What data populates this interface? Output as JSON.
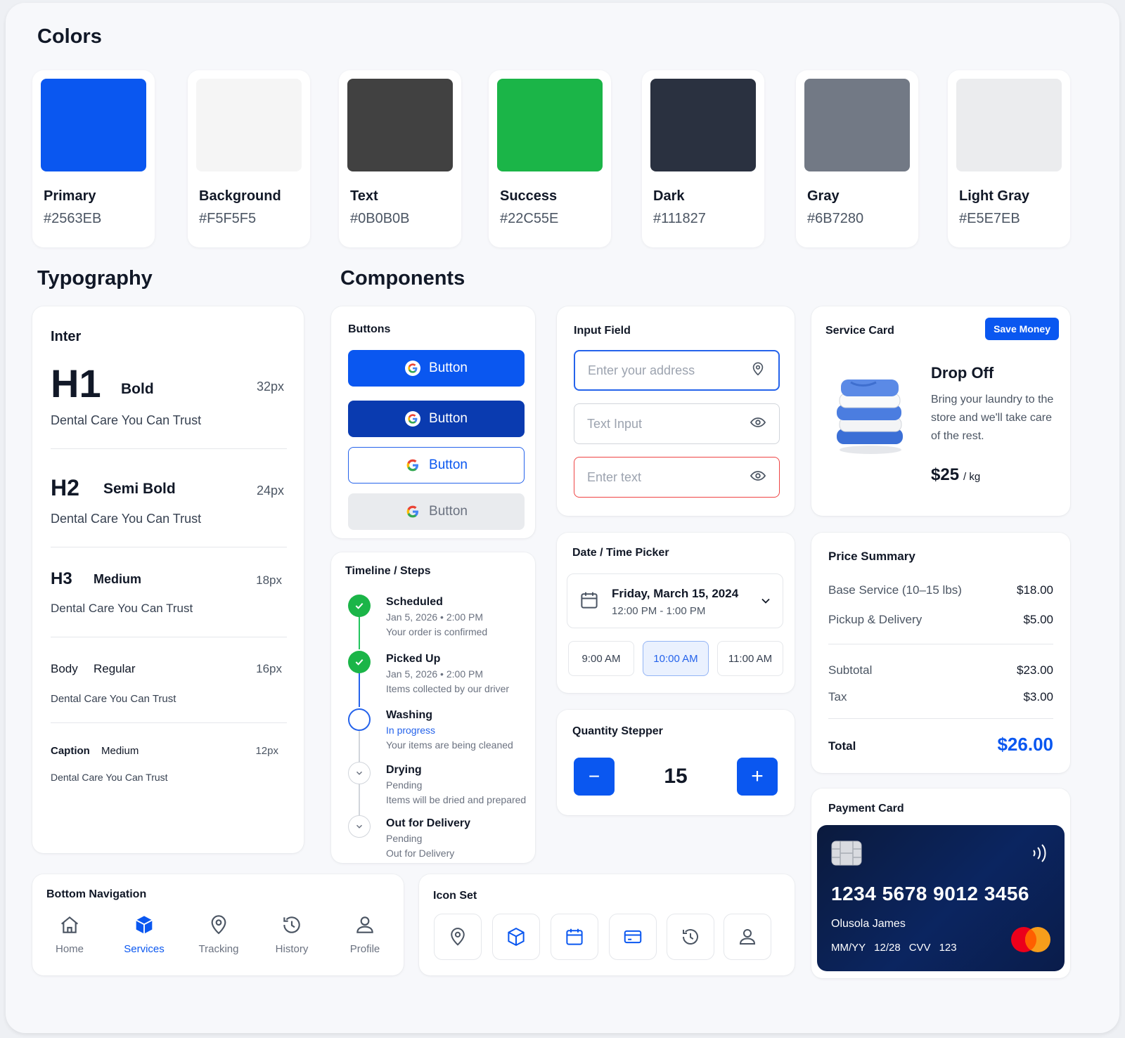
{
  "sections": {
    "colors": "Colors",
    "typography": "Typography",
    "components": "Components"
  },
  "colors": [
    {
      "name": "Primary",
      "hex": "#2563EB",
      "swatch": "#0a57f0"
    },
    {
      "name": "Background",
      "hex": "#F5F5F5",
      "swatch": "#f5f5f5"
    },
    {
      "name": "Text",
      "hex": "#0B0B0B",
      "swatch": "#414141"
    },
    {
      "name": "Success",
      "hex": "#22C55E",
      "swatch": "#1bb548"
    },
    {
      "name": "Dark",
      "hex": "#111827",
      "swatch": "#2a3140"
    },
    {
      "name": "Gray",
      "hex": "#6B7280",
      "swatch": "#727985"
    },
    {
      "name": "Light Gray",
      "hex": "#E5E7EB",
      "swatch": "#ebecee"
    }
  ],
  "typography": {
    "font_name": "Inter",
    "rows": [
      {
        "tag": "H1",
        "weight": "Bold",
        "size": "32px",
        "sample": "Dental Care You Can Trust"
      },
      {
        "tag": "H2",
        "weight": "Semi Bold",
        "size": "24px",
        "sample": "Dental Care You Can Trust"
      },
      {
        "tag": "H3",
        "weight": "Medium",
        "size": "18px",
        "sample": "Dental Care You Can Trust"
      },
      {
        "tag": "Body",
        "weight": "Regular",
        "size": "16px",
        "sample": "Dental Care You Can Trust"
      },
      {
        "tag": "Caption",
        "weight": "Medium",
        "size": "12px",
        "sample": "Dental Care You Can Trust"
      }
    ]
  },
  "buttons": {
    "title": "Buttons",
    "label": "Button"
  },
  "inputs": {
    "title": "Input Field",
    "address_placeholder": "Enter your address",
    "text_placeholder": "Text Input",
    "error_placeholder": "Enter text"
  },
  "service_card": {
    "title": "Service Card",
    "badge": "Save Money",
    "name": "Drop Off",
    "description": "Bring your laundry to the store and we'll take care of the rest.",
    "price": "$25",
    "unit": "/ kg"
  },
  "timeline": {
    "title": "Timeline / Steps",
    "steps": [
      {
        "title": "Scheduled",
        "line1": "Jan 5, 2026 • 2:00 PM",
        "line2": "Your order is confirmed"
      },
      {
        "title": "Picked Up",
        "line1": "Jan 5, 2026 • 2:00 PM",
        "line2": "Items collected by our driver"
      },
      {
        "title": "Washing",
        "line1": "In progress",
        "line2": "Your items are being cleaned"
      },
      {
        "title": "Drying",
        "line1": "Pending",
        "line2": "Items will be dried and prepared"
      },
      {
        "title": "Out for Delivery",
        "line1": "Pending",
        "line2": "Out for Delivery"
      }
    ]
  },
  "date_picker": {
    "title": "Date / Time Picker",
    "date": "Friday, March 15, 2024",
    "time_range": "12:00 PM - 1:00 PM",
    "slots": [
      "9:00 AM",
      "10:00 AM",
      "11:00 AM"
    ]
  },
  "price_summary": {
    "title": "Price Summary",
    "rows": [
      {
        "label": "Base Service (10–15 lbs)",
        "value": "$18.00"
      },
      {
        "label": "Pickup & Delivery",
        "value": "$5.00"
      },
      {
        "label": "Subtotal",
        "value": "$23.00"
      },
      {
        "label": "Tax",
        "value": "$3.00"
      }
    ],
    "total_label": "Total",
    "total_value": "$26.00"
  },
  "stepper": {
    "title": "Quantity Stepper",
    "value": "15",
    "minus": "−",
    "plus": "+"
  },
  "payment": {
    "title": "Payment Card",
    "number": "1234 5678 9012 3456",
    "holder": "Olusola James",
    "expiry_label": "MM/YY",
    "expiry": "12/28",
    "cvv_label": "CVV",
    "cvv": "123"
  },
  "bottom_nav": {
    "title": "Bottom Navigation",
    "items": [
      {
        "label": "Home",
        "icon": "home-icon"
      },
      {
        "label": "Services",
        "icon": "box-icon"
      },
      {
        "label": "Tracking",
        "icon": "map-pin-icon"
      },
      {
        "label": "History",
        "icon": "history-icon"
      },
      {
        "label": "Profile",
        "icon": "user-icon"
      }
    ]
  },
  "icon_set": {
    "title": "Icon Set",
    "icons": [
      "map-pin-icon",
      "box-icon",
      "calendar-icon",
      "card-icon",
      "history-icon",
      "user-icon"
    ]
  }
}
